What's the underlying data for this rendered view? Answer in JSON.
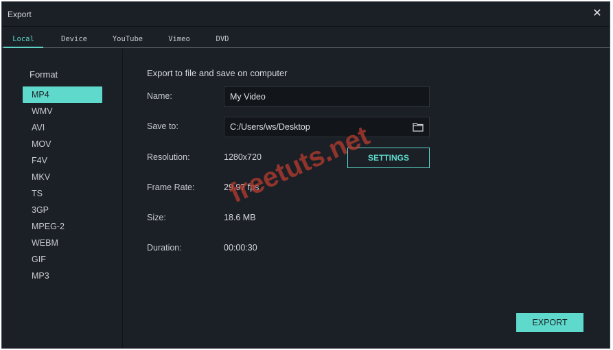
{
  "window": {
    "title": "Export"
  },
  "tabs": [
    {
      "label": "Local",
      "active": true
    },
    {
      "label": "Device",
      "active": false
    },
    {
      "label": "YouTube",
      "active": false
    },
    {
      "label": "Vimeo",
      "active": false
    },
    {
      "label": "DVD",
      "active": false
    }
  ],
  "sidebar": {
    "heading": "Format",
    "selected": "MP4",
    "formats": [
      "MP4",
      "WMV",
      "AVI",
      "MOV",
      "F4V",
      "MKV",
      "TS",
      "3GP",
      "MPEG-2",
      "WEBM",
      "GIF",
      "MP3"
    ]
  },
  "main": {
    "heading": "Export to file and save on computer",
    "name": {
      "label": "Name:",
      "value": "My Video"
    },
    "save_to": {
      "label": "Save to:",
      "value": "C:/Users/ws/Desktop",
      "icon": "folder-icon"
    },
    "resolution": {
      "label": "Resolution:",
      "value": "1280x720",
      "button": "SETTINGS"
    },
    "frame_rate": {
      "label": "Frame Rate:",
      "value": "29.97 fps"
    },
    "size": {
      "label": "Size:",
      "value": "18.6 MB"
    },
    "duration": {
      "label": "Duration:",
      "value": "00:00:30"
    },
    "export_button": "EXPORT"
  },
  "watermark": {
    "text": "freetuts.net",
    "color": "#b23a2e"
  },
  "colors": {
    "accent": "#5fd9cc",
    "background": "#1b2026"
  }
}
